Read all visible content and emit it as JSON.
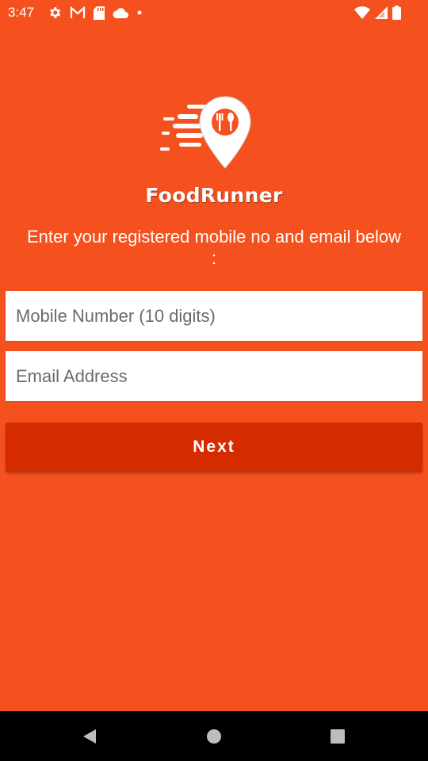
{
  "status_bar": {
    "time": "3:47",
    "left_icons": [
      "gear-icon",
      "gmail-icon",
      "sd-card-icon",
      "cloud-icon",
      "dot-icon"
    ],
    "right_icons": [
      "wifi-icon",
      "signal-icon",
      "battery-icon"
    ]
  },
  "brand": {
    "name": "FoodRunner",
    "logo_icon": "location-pin-fork-spoon-icon"
  },
  "form": {
    "instructions": "Enter your registered mobile no and email below :",
    "mobile_placeholder": "Mobile Number (10 digits)",
    "mobile_value": "",
    "email_placeholder": "Email Address",
    "email_value": "",
    "next_label": "Next"
  },
  "nav_bar": {
    "buttons": [
      "back-icon",
      "home-icon",
      "recents-icon"
    ]
  },
  "colors": {
    "background": "#f5511e",
    "button": "#d52b00",
    "input_bg": "#ffffff",
    "text_light": "#ffffff",
    "nav_bar": "#000000"
  }
}
